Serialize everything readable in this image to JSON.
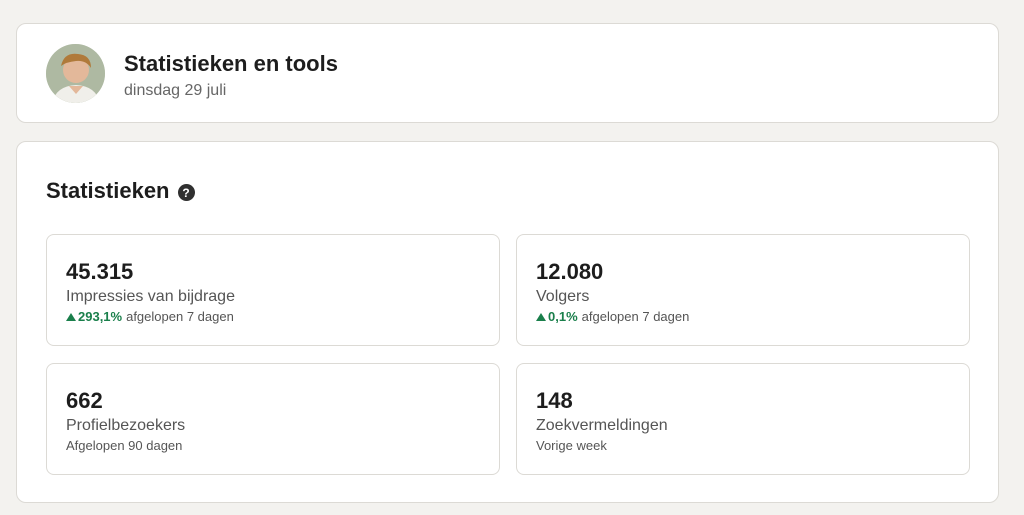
{
  "header": {
    "title": "Statistieken en tools",
    "date": "dinsdag 29 juli"
  },
  "stats": {
    "title": "Statistieken",
    "help_icon": "question-circle-icon",
    "tiles": [
      {
        "value": "45.315",
        "label": "Impressies van bijdrage",
        "trend_icon": "arrow-up-icon",
        "trend": "293,1%",
        "period": "afgelopen 7 dagen"
      },
      {
        "value": "12.080",
        "label": "Volgers",
        "trend_icon": "arrow-up-icon",
        "trend": "0,1%",
        "period": "afgelopen 7 dagen"
      },
      {
        "value": "662",
        "label": "Profielbezoekers",
        "period": "Afgelopen 90 dagen"
      },
      {
        "value": "148",
        "label": "Zoekvermeldingen",
        "period": "Vorige week"
      }
    ]
  },
  "colors": {
    "background": "#f3f2ef",
    "card": "#ffffff",
    "border": "#dcdad5",
    "positive": "#1a7f4b"
  }
}
